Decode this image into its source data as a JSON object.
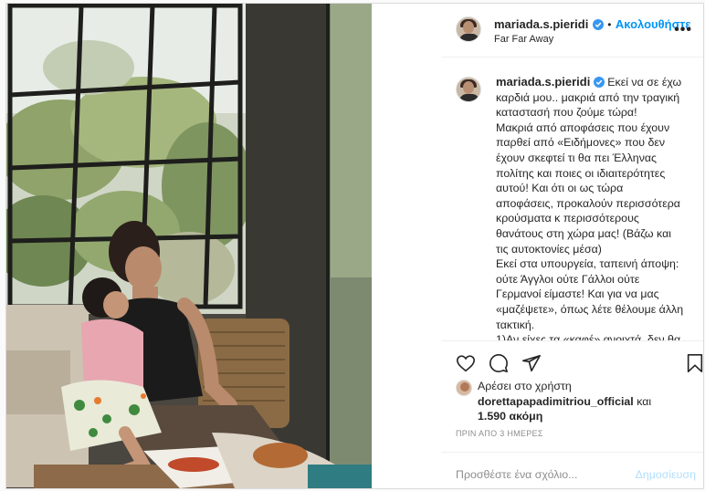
{
  "header": {
    "username": "mariada.s.pieridi",
    "follow_label": "Ακολουθήστε",
    "separator": "•",
    "location": "Far Far Away",
    "more_label": "•••"
  },
  "caption": {
    "username": "mariada.s.pieridi",
    "lines": [
      "Εκεί να σε έχω",
      "καρδιά μου.. μακριά από την τραγική",
      "καταστασή που ζούμε τώρα!",
      "Μακριά από αποφάσεις που έχουν",
      "παρθεί από «Ειδήμονες» που δεν",
      "έχουν σκεφτεί τι θα πει Έλληνας",
      "πολίτης και ποιες οι ιδιαιτερότητες",
      "αυτού! Και ότι οι ως τώρα",
      "αποφάσεις, προκαλούν περισσότερα",
      "κρούσματα κ περισσότερους",
      "θανάτους στη χώρα μας! (Βάζω και",
      "τις αυτοκτονίες μέσα)",
      "Εκεί στα υπουργεία, ταπεινή άποψη:",
      "ούτε Άγγλοι ούτε Γάλλοι ούτε",
      "Γερμανοί είμαστε! Και για να μας",
      "«μαζέψετε», όπως λέτε θέλουμε άλλη",
      "τακτική.",
      "1)Αν είχες τα «καφέ» ανοιχτά, δεν θα"
    ]
  },
  "likes": {
    "prefix": "Αρέσει στο χρήστη",
    "user": "dorettapapadimitriou_official",
    "and": "και",
    "count": "1.590 ακόμη"
  },
  "time_ago": "ΠΡΙΝ ΑΠΟ 3 ΗΜΕΡΕΣ",
  "comment": {
    "placeholder": "Προσθέστε ένα σχόλιο...",
    "post_label": "Δημοσίευση"
  },
  "colors": {
    "accent": "#0095f6",
    "verified": "#3897f0",
    "text": "#262626",
    "muted": "#8e8e8e",
    "post_disabled": "#b2dffc"
  }
}
